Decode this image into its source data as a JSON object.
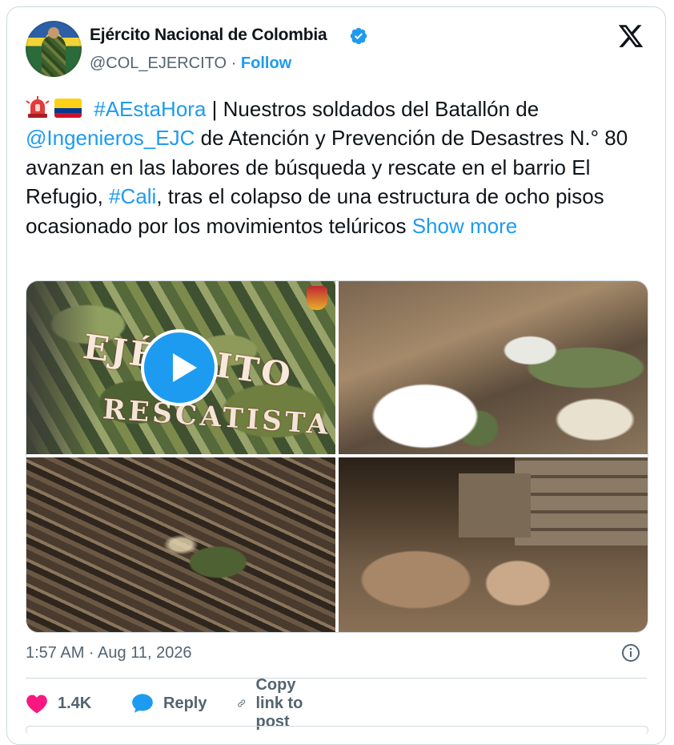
{
  "author": {
    "name": "Ejército Nacional de Colombia",
    "handle": "@COL_EJERCITO",
    "separator": "·",
    "follow_label": "Follow",
    "verified": true
  },
  "tweet": {
    "segments": [
      {
        "type": "text",
        "value": " "
      },
      {
        "type": "link",
        "value": "#AEstaHora"
      },
      {
        "type": "text",
        "value": " | Nuestros soldados del Batallón de "
      },
      {
        "type": "link",
        "value": "@Ingenieros_EJC"
      },
      {
        "type": "text",
        "value": " de Atención y Prevención de Desastres N.° 80 avanzan en las labores de búsqueda y rescate en el barrio El Refugio, "
      },
      {
        "type": "link",
        "value": "#Cali"
      },
      {
        "type": "text",
        "value": ", tras el colapso de una estructura de ocho pisos ocasionado por los movimientos telúricos "
      },
      {
        "type": "link",
        "value": "Show more"
      }
    ],
    "media": {
      "video_overlay_text_line1": "EJÉRCITO",
      "video_overlay_text_line2": "RESCATISTA"
    },
    "timestamp": "1:57 AM · Aug 11, 2026"
  },
  "actions": {
    "likes_count": "1.4K",
    "reply_label": "Reply",
    "copy_link_label": "Copy link to post"
  },
  "colors": {
    "link": "#1d9bf0",
    "muted": "#536471",
    "like": "#f91880",
    "border": "#cfd9de"
  }
}
